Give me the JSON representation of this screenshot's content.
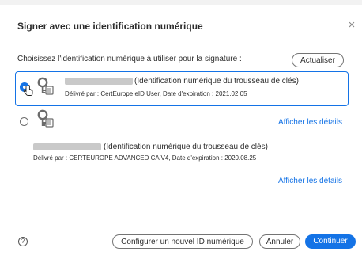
{
  "dialog": {
    "title": "Signer avec une identification numérique",
    "close_glyph": "×",
    "prompt": "Choisissez l'identification numérique à utiliser pour la signature :",
    "refresh_label": "Actualiser"
  },
  "identities": [
    {
      "selected": true,
      "type_label": "(Identification numérique du trousseau de clés)",
      "details": "Délivré par : CertEurope eID User, Date d'expiration : 2021.02.05"
    },
    {
      "selected": false,
      "type_label": "(Identification numérique du trousseau de clés)",
      "details": "Délivré par : CERTEUROPE ADVANCED CA V4, Date d'expiration : 2020.08.25",
      "show_details": "Afficher les détails"
    },
    {
      "show_details": "Afficher les détails"
    }
  ],
  "footer": {
    "help_glyph": "?",
    "configure_label": "Configurer un nouvel ID numérique",
    "cancel_label": "Annuler",
    "continue_label": "Continuer"
  },
  "colors": {
    "accent": "#1473e6",
    "text": "#2c2c2c",
    "redaction": "#c9c9c9"
  },
  "icons": [
    "key-certificate-icon",
    "cursor-hand-icon",
    "help-icon",
    "close-icon"
  ]
}
